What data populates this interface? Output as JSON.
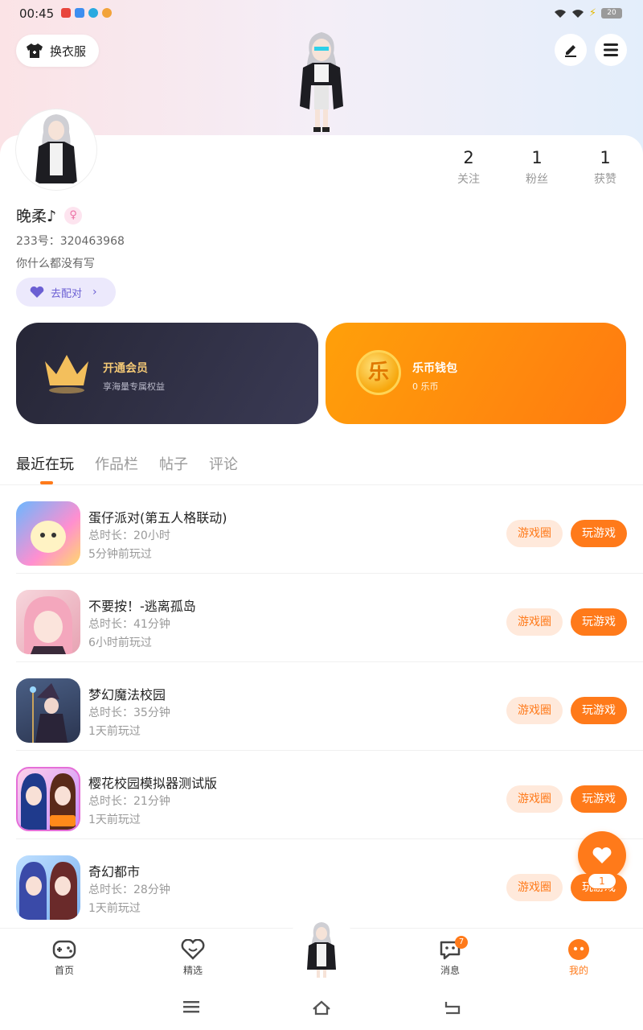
{
  "status_bar": {
    "time": "00:45",
    "battery": "20"
  },
  "header": {
    "outfit_label": "换衣服"
  },
  "profile": {
    "stats": [
      {
        "num": "2",
        "label": "关注"
      },
      {
        "num": "1",
        "label": "粉丝"
      },
      {
        "num": "1",
        "label": "获赞"
      }
    ],
    "username": "晚柔♪",
    "uid": "233号：320463968",
    "bio": "你什么都没有写",
    "pair_label": "去配对"
  },
  "promos": {
    "vip_title": "开通会员",
    "vip_sub": "享海量专属权益",
    "wallet_title": "乐币钱包",
    "wallet_sub": "0 乐币",
    "coin_glyph": "乐"
  },
  "tabs": [
    "最近在玩",
    "作品栏",
    "帖子",
    "评论"
  ],
  "games": [
    {
      "name": "蛋仔派对(第五人格联动)",
      "duration": "总时长：20小时",
      "last": "5分钟前玩过",
      "circle": "游戏圈",
      "play": "玩游戏"
    },
    {
      "name": "不要按！-逃离孤岛",
      "duration": "总时长：41分钟",
      "last": "6小时前玩过",
      "circle": "游戏圈",
      "play": "玩游戏"
    },
    {
      "name": "梦幻魔法校园",
      "duration": "总时长：35分钟",
      "last": "1天前玩过",
      "circle": "游戏圈",
      "play": "玩游戏"
    },
    {
      "name": "樱花校园模拟器测试版",
      "duration": "总时长：21分钟",
      "last": "1天前玩过",
      "circle": "游戏圈",
      "play": "玩游戏"
    },
    {
      "name": "奇幻都市",
      "duration": "总时长：28分钟",
      "last": "1天前玩过",
      "circle": "游戏圈",
      "play": "玩游戏"
    }
  ],
  "floating": {
    "count": "1"
  },
  "bottom_nav": {
    "home": "首页",
    "featured": "精选",
    "messages": "消息",
    "messages_badge": "7",
    "mine": "我的"
  },
  "colors": {
    "accent": "#ff7a1a",
    "vip_gold": "#f3c875",
    "pair_purple": "#6b5fd3"
  }
}
